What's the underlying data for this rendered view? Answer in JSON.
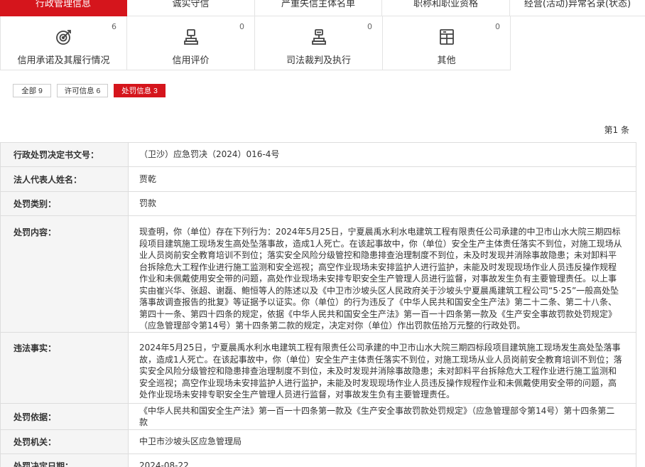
{
  "tabs": [
    {
      "label": "行政管理信息",
      "active": true
    },
    {
      "label": "诚实守信",
      "active": false
    },
    {
      "label": "严重失信主体名单",
      "active": false
    },
    {
      "label": "职称和职业资格",
      "active": false
    },
    {
      "label": "经营(活动)异常名录(状态)",
      "active": false
    }
  ],
  "categories": [
    {
      "label": "信用承诺及其履行情况",
      "count": "6",
      "icon": "target-icon"
    },
    {
      "label": "信用评价",
      "count": "0",
      "icon": "trophy-icon"
    },
    {
      "label": "司法裁判及执行",
      "count": "0",
      "icon": "gavel-icon"
    },
    {
      "label": "其他",
      "count": "0",
      "icon": "document-grid-icon"
    }
  ],
  "filters": [
    {
      "label": "全部 9",
      "active": false
    },
    {
      "label": "许可信息 6",
      "active": false
    },
    {
      "label": "处罚信息 3",
      "active": true
    }
  ],
  "total": "第1 条",
  "detail": {
    "doc_no": {
      "key": "行政处罚决定书文号：",
      "value": "（卫沙）应急罚决（2024）016-4号"
    },
    "legal_rep": {
      "key": "法人代表人姓名：",
      "value": "贾乾"
    },
    "category": {
      "key": "处罚类别：",
      "value": "罚款"
    },
    "content": {
      "key": "处罚内容：",
      "value": "现查明，你（单位）存在下列行为：2024年5月25日，宁夏晨禹水利水电建筑工程有限责任公司承建的中卫市山水大院三期四标段项目建筑施工现场发生高处坠落事故，造成1人死亡。在该起事故中，你（单位）安全生产主体责任落实不到位，对施工现场从业人员岗前安全教育培训不到位；落实安全风险分级管控和隐患排查治理制度不到位，未及时发现并消除事故隐患；未对卸料平台拆除危大工程作业进行施工监测和安全巡视；高空作业现场未安排监护人进行监护，未能及时发现现场作业人员违反操作规程作业和未佩戴使用安全带的问题，高处作业现场未安排专职安全生产管理人员进行监督，对事故发生负有主要管理责任。以上事实由崔兴华、张超、谢磊、鲍恒等人的陈述以及《中卫市沙坡头区人民政府关于沙坡头宁夏晨禹建筑工程公司“5·25”一般高处坠落事故调查报告的批复》等证据予以证实。你（单位）的行为违反了《中华人民共和国安全生产法》第二十二条、第二十八条、第四十一条、第四十四条的规定，依据《中华人民共和国安全生产法》第一百一十四条第一款及《生产安全事故罚款处罚规定》（应急管理部令第14号）第十四条第二款的规定，决定对你（单位）作出罚款伍拾万元整的行政处罚。"
    },
    "facts": {
      "key": "违法事实：",
      "value": "2024年5月25日，宁夏晨禹水利水电建筑工程有限责任公司承建的中卫市山水大院三期四标段项目建筑施工现场发生高处坠落事故，造成1人死亡。在该起事故中，你（单位）安全生产主体责任落实不到位，对施工现场从业人员岗前安全教育培训不到位；落实安全风险分级管控和隐患排查治理制度不到位，未及时发现并消除事故隐患；未对卸料平台拆除危大工程作业进行施工监测和安全巡视；高空作业现场未安排监护人进行监护，未能及时发现现场作业人员违反操作规程作业和未佩戴使用安全带的问题，高处作业现场未安排专职安全生产管理人员进行监督，对事故发生负有主要管理责任。"
    },
    "basis": {
      "key": "处罚依据：",
      "value": "《中华人民共和国安全生产法》第一百一十四条第一款及《生产安全事故罚款处罚规定》（应急管理部令第14号）第十四条第二款"
    },
    "authority": {
      "key": "处罚机关：",
      "value": "中卫市沙坡头区应急管理局"
    },
    "date": {
      "key": "处罚决定日期：",
      "value": "2024-08-22"
    }
  },
  "colors": {
    "accent": "#d5151c",
    "label_bg": "#f5f5f5",
    "border": "#dddddd"
  }
}
